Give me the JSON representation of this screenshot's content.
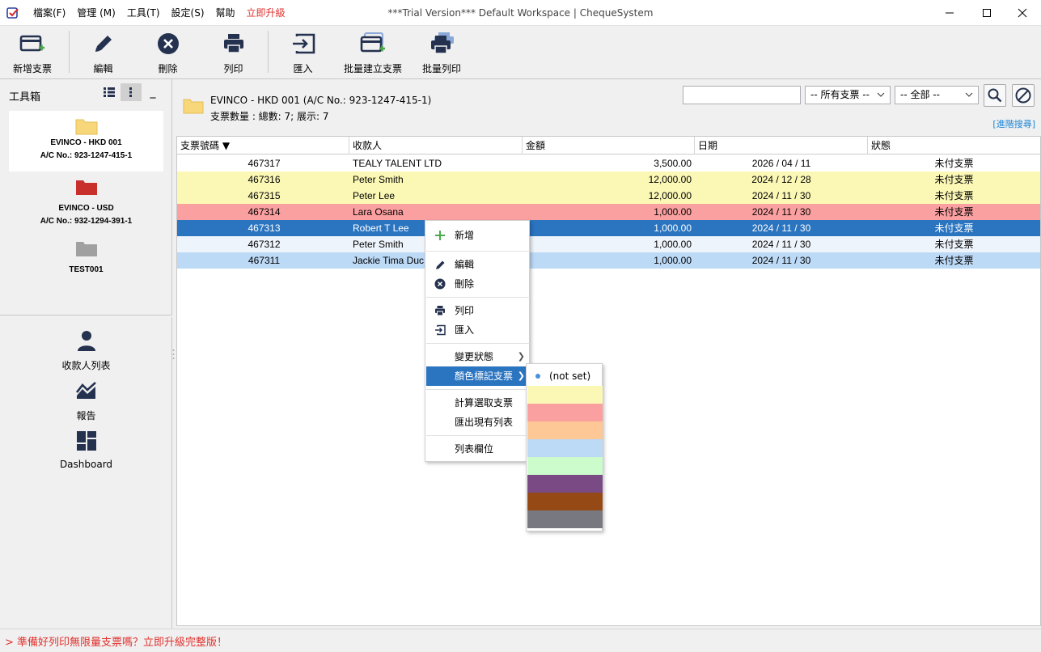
{
  "window": {
    "title": "***Trial Version*** Default Workspace | ChequeSystem",
    "menu": [
      "檔案(F)",
      "管理 (M)",
      "工具(T)",
      "設定(S)",
      "幫助",
      "立即升級"
    ]
  },
  "toolbar": {
    "new_cheque": "新增支票",
    "edit": "編輯",
    "delete": "刪除",
    "print": "列印",
    "import": "匯入",
    "batch_create": "批量建立支票",
    "batch_print": "批量列印"
  },
  "toolbox": {
    "title": "工具箱",
    "collapse_label": "_",
    "accounts": [
      {
        "name": "EVINCO - HKD 001",
        "acno": "A/C No.: 923-1247-415-1",
        "color": "#f8d77a"
      },
      {
        "name": "EVINCO - USD",
        "acno": "A/C No.: 932-1294-391-1",
        "color": "#c8302c"
      },
      {
        "name": "TEST001",
        "acno": "",
        "color": "#a0a0a0"
      }
    ]
  },
  "nav": {
    "payee_list": "收款人列表",
    "reports": "報告",
    "dashboard": "Dashboard"
  },
  "header": {
    "account": "EVINCO - HKD 001 (A/C No.: 923-1247-415-1)",
    "count": "支票數量 : 總數: 7; 展示: 7",
    "search_value": "",
    "filter_all_cheques": "-- 所有支票 --",
    "filter_all": "-- 全部 --",
    "advanced_search": "[進階搜尋]"
  },
  "table": {
    "columns": [
      "支票號碼 ▼",
      "收款人",
      "金額",
      "日期",
      "狀態"
    ],
    "rows": [
      {
        "no": "467317",
        "payee": "TEALY TALENT LTD",
        "amount": "3,500.00",
        "date": "2026 / 04 / 11",
        "status": "未付支票",
        "bg": "#ffffff",
        "fg": "#000000"
      },
      {
        "no": "467316",
        "payee": "Peter Smith",
        "amount": "12,000.00",
        "date": "2024 / 12 / 28",
        "status": "未付支票",
        "bg": "#fbf8b6",
        "fg": "#000000"
      },
      {
        "no": "467315",
        "payee": "Peter Lee",
        "amount": "12,000.00",
        "date": "2024 / 11 / 30",
        "status": "未付支票",
        "bg": "#fbf8b6",
        "fg": "#000000"
      },
      {
        "no": "467314",
        "payee": "Lara Osana",
        "amount": "1,000.00",
        "date": "2024 / 11 / 30",
        "status": "未付支票",
        "bg": "#fba0a0",
        "fg": "#000000"
      },
      {
        "no": "467313",
        "payee": "Robert T Lee",
        "amount": "1,000.00",
        "date": "2024 / 11 / 30",
        "status": "未付支票",
        "bg": "#2a74c0",
        "fg": "#ffffff"
      },
      {
        "no": "467312",
        "payee": "Peter Smith",
        "amount": "1,000.00",
        "date": "2024 / 11 / 30",
        "status": "未付支票",
        "bg": "#eef4fb",
        "fg": "#000000"
      },
      {
        "no": "467311",
        "payee": "Jackie Tima Duc",
        "amount": "1,000.00",
        "date": "2024 / 11 / 30",
        "status": "未付支票",
        "bg": "#bcd9f6",
        "fg": "#000000"
      }
    ]
  },
  "context_menu": {
    "add": "新增",
    "edit": "編輯",
    "delete": "刪除",
    "print": "列印",
    "import": "匯入",
    "change_status": "變更狀態",
    "color_tag": "顏色標記支票",
    "calc_selected": "計算選取支票",
    "export_list": "匯出現有列表",
    "list_columns": "列表欄位"
  },
  "color_menu": {
    "not_set": "(not set)",
    "swatches": [
      "#fbf8b6",
      "#fba0a0",
      "#fdc895",
      "#bcd9f6",
      "#ccfccc",
      "#7a4a84",
      "#954a16",
      "#787880"
    ]
  },
  "status_bar": {
    "text": "> 準備好列印無限量支票嗎？立即升級完整版！"
  }
}
